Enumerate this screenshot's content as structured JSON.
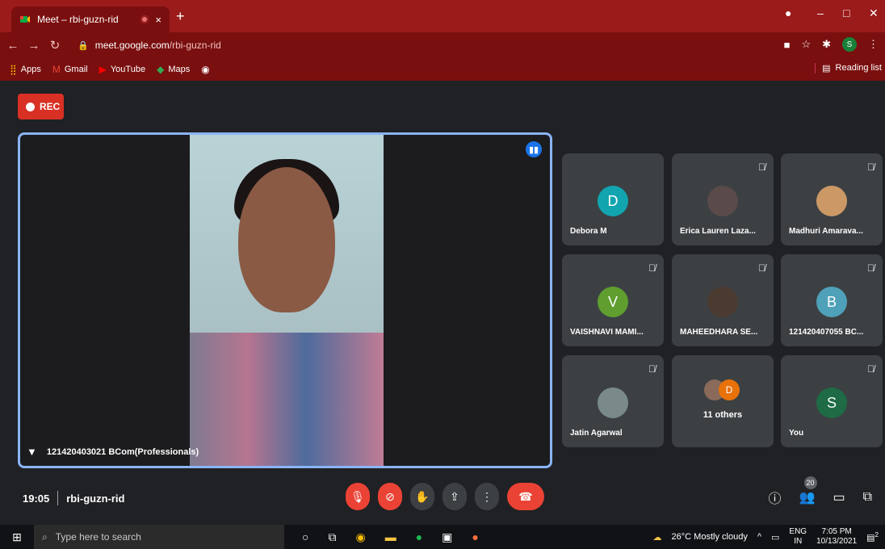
{
  "browser": {
    "tab_title": "Meet – rbi-guzn-rid",
    "tab_close": "×",
    "new_tab": "+",
    "url_host": "meet.google.com",
    "url_path": "/rbi-guzn-rid",
    "profile_initial": "S",
    "window_controls": [
      "–",
      "□",
      "✕"
    ],
    "bookmarks": [
      {
        "label": "Apps",
        "icon": "apps-grid-icon"
      },
      {
        "label": "Gmail",
        "icon": "gmail-icon"
      },
      {
        "label": "YouTube",
        "icon": "youtube-icon"
      },
      {
        "label": "Maps",
        "icon": "maps-icon"
      }
    ],
    "reading_list": "Reading list"
  },
  "meet": {
    "rec_label": "REC",
    "main_participant": "121420403021 BCom(Professionals)",
    "participants": [
      {
        "name": "Debora M",
        "initial": "D",
        "color": "#12a4af",
        "muted": false,
        "photo": false
      },
      {
        "name": "Erica Lauren Laza...",
        "initial": "",
        "color": "#5a4a4a",
        "muted": true,
        "photo": true
      },
      {
        "name": "Madhuri Amarava...",
        "initial": "",
        "color": "#c96",
        "muted": true,
        "photo": true
      },
      {
        "name": "VAISHNAVI MAMI...",
        "initial": "V",
        "color": "#5f9e2f",
        "muted": true,
        "photo": false
      },
      {
        "name": "MAHEEDHARA SE...",
        "initial": "",
        "color": "#4a3a30",
        "muted": true,
        "photo": true
      },
      {
        "name": "121420407055 BC...",
        "initial": "B",
        "color": "#4fa1b9",
        "muted": true,
        "photo": false
      },
      {
        "name": "Jatin Agarwal",
        "initial": "",
        "color": "#7a8a8a",
        "muted": true,
        "photo": true
      },
      {
        "name": "11 others",
        "initial": "D",
        "color": "#e8710a",
        "muted": false,
        "photo": false,
        "others": true
      },
      {
        "name": "You",
        "initial": "S",
        "color": "#1e6b45",
        "muted": true,
        "photo": false
      }
    ],
    "time": "19:05",
    "meeting_code": "rbi-guzn-rid",
    "people_count": "20"
  },
  "taskbar": {
    "search_placeholder": "Type here to search",
    "weather": "26°C  Mostly cloudy",
    "lang_top": "ENG",
    "lang_bottom": "IN",
    "time": "7:05 PM",
    "date": "10/13/2021",
    "notif_count": "2"
  }
}
